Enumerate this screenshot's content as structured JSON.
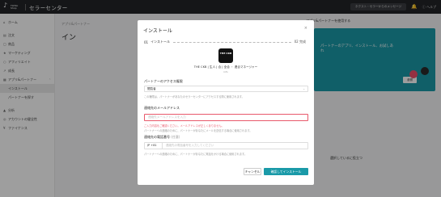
{
  "topbar": {
    "logo_text": "TikTok Shop",
    "title": "セラーセンター",
    "messages_label": "ネクスト・セラーからのメッセージ",
    "help_label": "ヘルプ"
  },
  "sidebar": {
    "items": [
      {
        "label": "ホーム"
      },
      {
        "label": "注文"
      },
      {
        "label": "商品"
      },
      {
        "label": "マーケティング"
      },
      {
        "label": "アフィリエイト"
      },
      {
        "label": "成長"
      },
      {
        "label": "アプリ&パートナー"
      },
      {
        "label": "インストール"
      },
      {
        "label": "パートナーを探す"
      },
      {
        "label": "分析"
      },
      {
        "label": "アカウントの健全性"
      },
      {
        "label": "ファイナンス"
      }
    ]
  },
  "background": {
    "breadcrumb": "アプリ&パートナー",
    "title": "イン",
    "promo_heading": "アプリ&パートナーを使用する",
    "promo_text": "パートナーのアプリ、インストール、お試しあれ",
    "promo_button": "参照",
    "right_text": "選択しているに役立つ"
  },
  "modal": {
    "title": "インストール",
    "close_icon": "×",
    "step1_num": "01",
    "step1_label": "インストール",
    "step2_label": "02 完成",
    "app_logo_text": "THE CKB",
    "app_caption": "THE CKB | 生人 | 合 | 全合 ・ 連合マネージャー",
    "app_sub": "info",
    "access_label": "パートナーのアクセス権限",
    "access_value": "閲覧者",
    "access_hint": "この権限は、パートナーがあなたのセラーセンターにアクセスする際に使用されます。",
    "email_label": "連絡先のメールアドレス",
    "email_placeholder": "連絡先メールアドレスを入力",
    "email_error": "ご入力内容をご確認ください。メールアドレスが正しくありません。",
    "email_hint": "パートナーへの連絡のために、パートナーがあなたにメールを送信する場合に使用されます。",
    "phone_label": "連絡先の電話番号",
    "phone_optional": "(任意)",
    "country_code": "JP +81",
    "phone_placeholder": "連絡先の電話番号を入力してください",
    "phone_hint": "パートナーへの連絡のために、パートナーがあなたに電話をかける場合に使用されます。",
    "cancel_label": "キャンセル",
    "confirm_label": "確認してインストール"
  },
  "colors": {
    "accent": "#1a9aa8",
    "error": "#e8596b",
    "topbar": "#222528"
  }
}
